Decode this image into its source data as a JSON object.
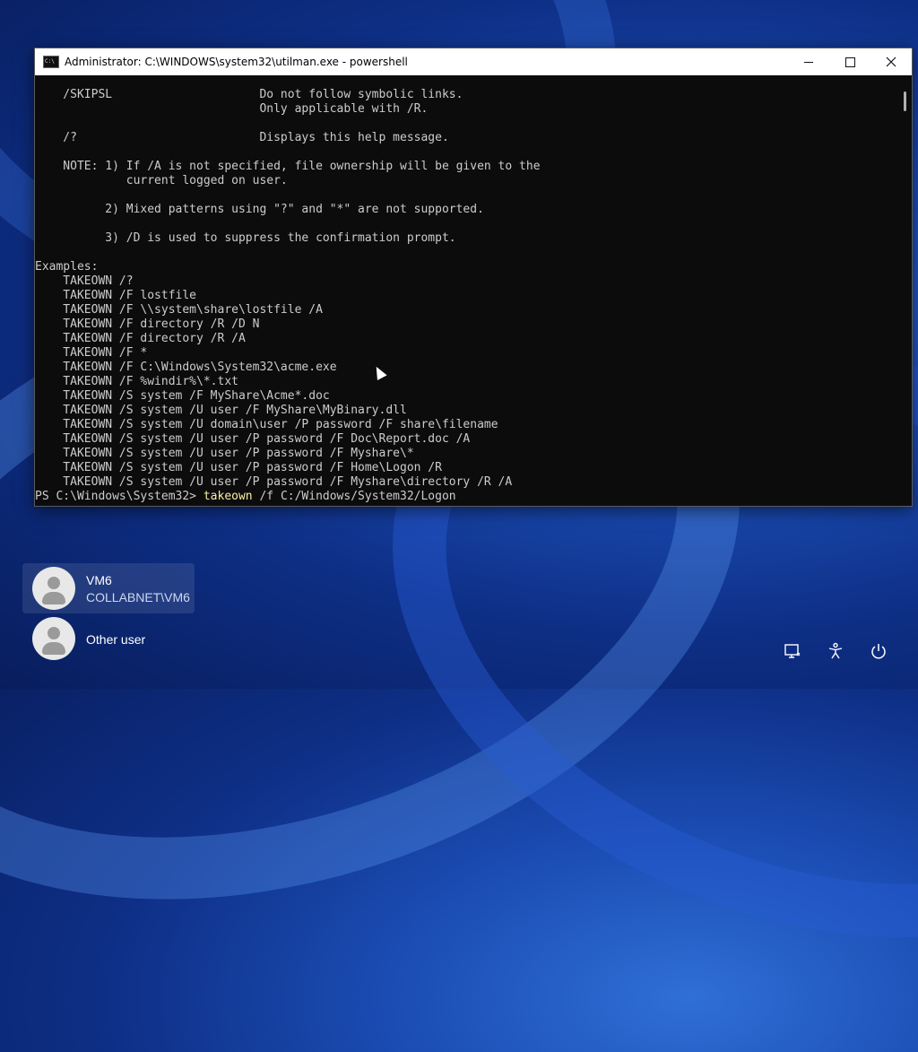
{
  "window": {
    "title": "Administrator: C:\\WINDOWS\\system32\\utilman.exe - powershell",
    "controls": {
      "minimize": "minimize-icon",
      "maximize": "maximize-icon",
      "close": "close-icon"
    }
  },
  "console": {
    "text": "    /SKIPSL                     Do not follow symbolic links.\n                                Only applicable with /R.\n\n    /?                          Displays this help message.\n\n    NOTE: 1) If /A is not specified, file ownership will be given to the\n             current logged on user.\n\n          2) Mixed patterns using \"?\" and \"*\" are not supported.\n\n          3) /D is used to suppress the confirmation prompt.\n\nExamples:\n    TAKEOWN /?\n    TAKEOWN /F lostfile\n    TAKEOWN /F \\\\system\\share\\lostfile /A\n    TAKEOWN /F directory /R /D N\n    TAKEOWN /F directory /R /A\n    TAKEOWN /F *\n    TAKEOWN /F C:\\Windows\\System32\\acme.exe\n    TAKEOWN /F %windir%\\*.txt\n    TAKEOWN /S system /F MyShare\\Acme*.doc\n    TAKEOWN /S system /U user /F MyShare\\MyBinary.dll\n    TAKEOWN /S system /U domain\\user /P password /F share\\filename\n    TAKEOWN /S system /U user /P password /F Doc\\Report.doc /A\n    TAKEOWN /S system /U user /P password /F Myshare\\*\n    TAKEOWN /S system /U user /P password /F Home\\Logon /R\n    TAKEOWN /S system /U user /P password /F Myshare\\directory /R /A",
    "prompt": "PS C:\\Windows\\System32> ",
    "command": "takeown",
    "args": " /f C:/Windows/System32/Logon"
  },
  "users": [
    {
      "name": "VM6",
      "domain": "COLLABNET\\VM6"
    },
    {
      "name": "Other user"
    }
  ],
  "system_icons": [
    "network-icon",
    "accessibility-icon",
    "power-icon"
  ]
}
